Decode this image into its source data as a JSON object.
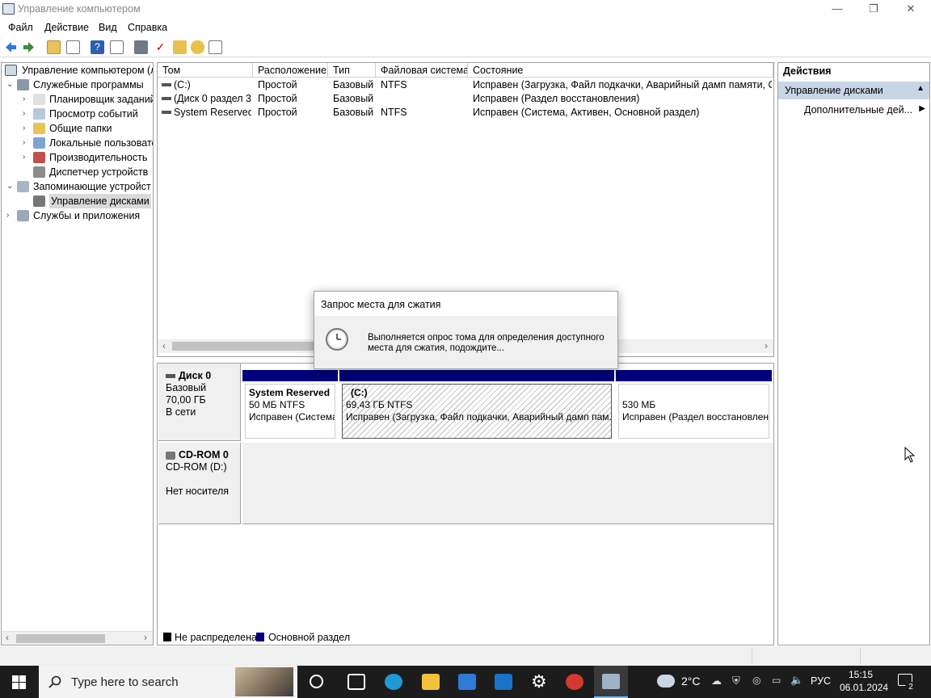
{
  "window": {
    "title": "Управление компьютером",
    "controls": {
      "minimize": "—",
      "restore": "❐",
      "close": "✕"
    }
  },
  "menu": [
    "Файл",
    "Действие",
    "Вид",
    "Справка"
  ],
  "toolbar_icons": [
    "back-arrow",
    "forward-arrow",
    "up-folder",
    "show-hide-tree",
    "help",
    "properties",
    "connect",
    "checkmark",
    "export",
    "search",
    "list-view"
  ],
  "tree": {
    "root": "Управление компьютером (л",
    "items": [
      {
        "label": "Служебные программы",
        "level": 1,
        "chev": "⌄",
        "icon": "tools"
      },
      {
        "label": "Планировщик заданий",
        "level": 2,
        "chev": "›",
        "icon": "clock"
      },
      {
        "label": "Просмотр событий",
        "level": 2,
        "chev": "›",
        "icon": "event-viewer"
      },
      {
        "label": "Общие папки",
        "level": 2,
        "chev": "›",
        "icon": "shared-folder"
      },
      {
        "label": "Локальные пользовате",
        "level": 2,
        "chev": "›",
        "icon": "users"
      },
      {
        "label": "Производительность",
        "level": 2,
        "chev": "›",
        "icon": "performance"
      },
      {
        "label": "Диспетчер устройств",
        "level": 2,
        "chev": "",
        "icon": "device-manager"
      },
      {
        "label": "Запоминающие устройст",
        "level": 1,
        "chev": "⌄",
        "icon": "storage"
      },
      {
        "label": "Управление дисками",
        "level": 2,
        "chev": "",
        "icon": "disk",
        "selected": true
      },
      {
        "label": "Службы и приложения",
        "level": 1,
        "chev": "›",
        "icon": "services"
      }
    ]
  },
  "volumes": {
    "columns": [
      "Том",
      "Расположение",
      "Тип",
      "Файловая система",
      "Состояние"
    ],
    "rows": [
      [
        "(C:)",
        "Простой",
        "Базовый",
        "NTFS",
        "Исправен (Загрузка, Файл подкачки, Аварийный дамп памяти, Осн"
      ],
      [
        "(Диск 0 раздел 3)",
        "Простой",
        "Базовый",
        "",
        "Исправен (Раздел восстановления)"
      ],
      [
        "System Reserved",
        "Простой",
        "Базовый",
        "NTFS",
        "Исправен (Система, Активен, Основной раздел)"
      ]
    ]
  },
  "disks": {
    "disk0": {
      "name": "Диск 0",
      "type": "Базовый",
      "size": "70,00 ГБ",
      "status": "В сети"
    },
    "cdrom": {
      "name": "CD-ROM 0",
      "drive": "CD-ROM (D:)",
      "status": "Нет носителя"
    },
    "partitions": [
      {
        "name": "System Reserved",
        "size": "50 МБ NTFS",
        "status": "Исправен (Система"
      },
      {
        "name": "(C:)",
        "size": "69,43 ГБ NTFS",
        "status": "Исправен (Загрузка, Файл подкачки, Аварийный дамп пам."
      },
      {
        "name": "",
        "size": "530 МБ",
        "status": "Исправен (Раздел восстановлен"
      }
    ]
  },
  "legend": [
    {
      "label": "Не распределена",
      "color": "#000000"
    },
    {
      "label": "Основной раздел",
      "color": "#00007a"
    }
  ],
  "actions": {
    "header": "Действия",
    "section": "Управление дисками",
    "more": "Дополнительные дей..."
  },
  "dialog": {
    "title": "Запрос места для сжатия",
    "message_line1": "Выполняется опрос тома для определения доступного",
    "message_line2": "места для сжатия, подождите..."
  },
  "taskbar": {
    "search_placeholder": "Type here to search",
    "temperature": "2°C",
    "language": "РУС",
    "time": "15:15",
    "date": "06.01.2024",
    "notifications": "2"
  },
  "colors": {
    "accent": "#0078d7",
    "primary_partition": "#00007a",
    "selected_section": "#c8d5e6"
  }
}
